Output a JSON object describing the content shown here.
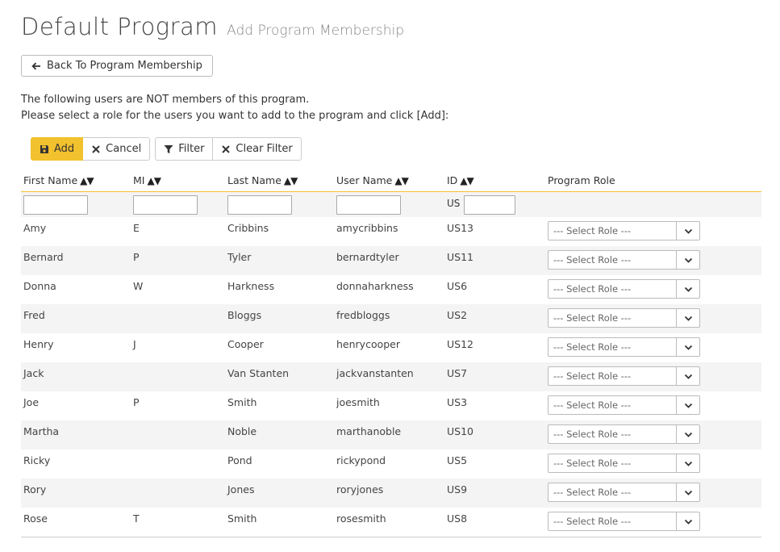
{
  "page": {
    "title": "Default Program",
    "subtitle": "Add Program Membership",
    "back_label": "Back To Program Membership",
    "intro_line1": "The following users are NOT members of this program.",
    "intro_line2": "Please select a role for the users you want to add to the program and click [Add]:"
  },
  "toolbar": {
    "add_label": "Add",
    "cancel_label": "Cancel",
    "filter_label": "Filter",
    "clear_filter_label": "Clear Filter"
  },
  "table": {
    "columns": {
      "first_name": "First Name",
      "mi": "MI",
      "last_name": "Last Name",
      "user_name": "User Name",
      "id": "ID",
      "role": "Program Role"
    },
    "sort_glyph": "▲▼",
    "id_filter_prefix": "US",
    "role_placeholder": "--- Select Role ---",
    "rows": [
      {
        "first": "Amy",
        "mi": "E",
        "last": "Cribbins",
        "user": "amycribbins",
        "id": "US13"
      },
      {
        "first": "Bernard",
        "mi": "P",
        "last": "Tyler",
        "user": "bernardtyler",
        "id": "US11"
      },
      {
        "first": "Donna",
        "mi": "W",
        "last": "Harkness",
        "user": "donnaharkness",
        "id": "US6"
      },
      {
        "first": "Fred",
        "mi": "",
        "last": "Bloggs",
        "user": "fredbloggs",
        "id": "US2"
      },
      {
        "first": "Henry",
        "mi": "J",
        "last": "Cooper",
        "user": "henrycooper",
        "id": "US12"
      },
      {
        "first": "Jack",
        "mi": "",
        "last": "Van Stanten",
        "user": "jackvanstanten",
        "id": "US7"
      },
      {
        "first": "Joe",
        "mi": "P",
        "last": "Smith",
        "user": "joesmith",
        "id": "US3"
      },
      {
        "first": "Martha",
        "mi": "",
        "last": "Noble",
        "user": "marthanoble",
        "id": "US10"
      },
      {
        "first": "Ricky",
        "mi": "",
        "last": "Pond",
        "user": "rickypond",
        "id": "US5"
      },
      {
        "first": "Rory",
        "mi": "",
        "last": "Jones",
        "user": "roryjones",
        "id": "US9"
      },
      {
        "first": "Rose",
        "mi": "T",
        "last": "Smith",
        "user": "rosesmith",
        "id": "US8"
      }
    ]
  },
  "colors": {
    "accent": "#f2c12e",
    "row_alt": "#f4f4f4"
  }
}
